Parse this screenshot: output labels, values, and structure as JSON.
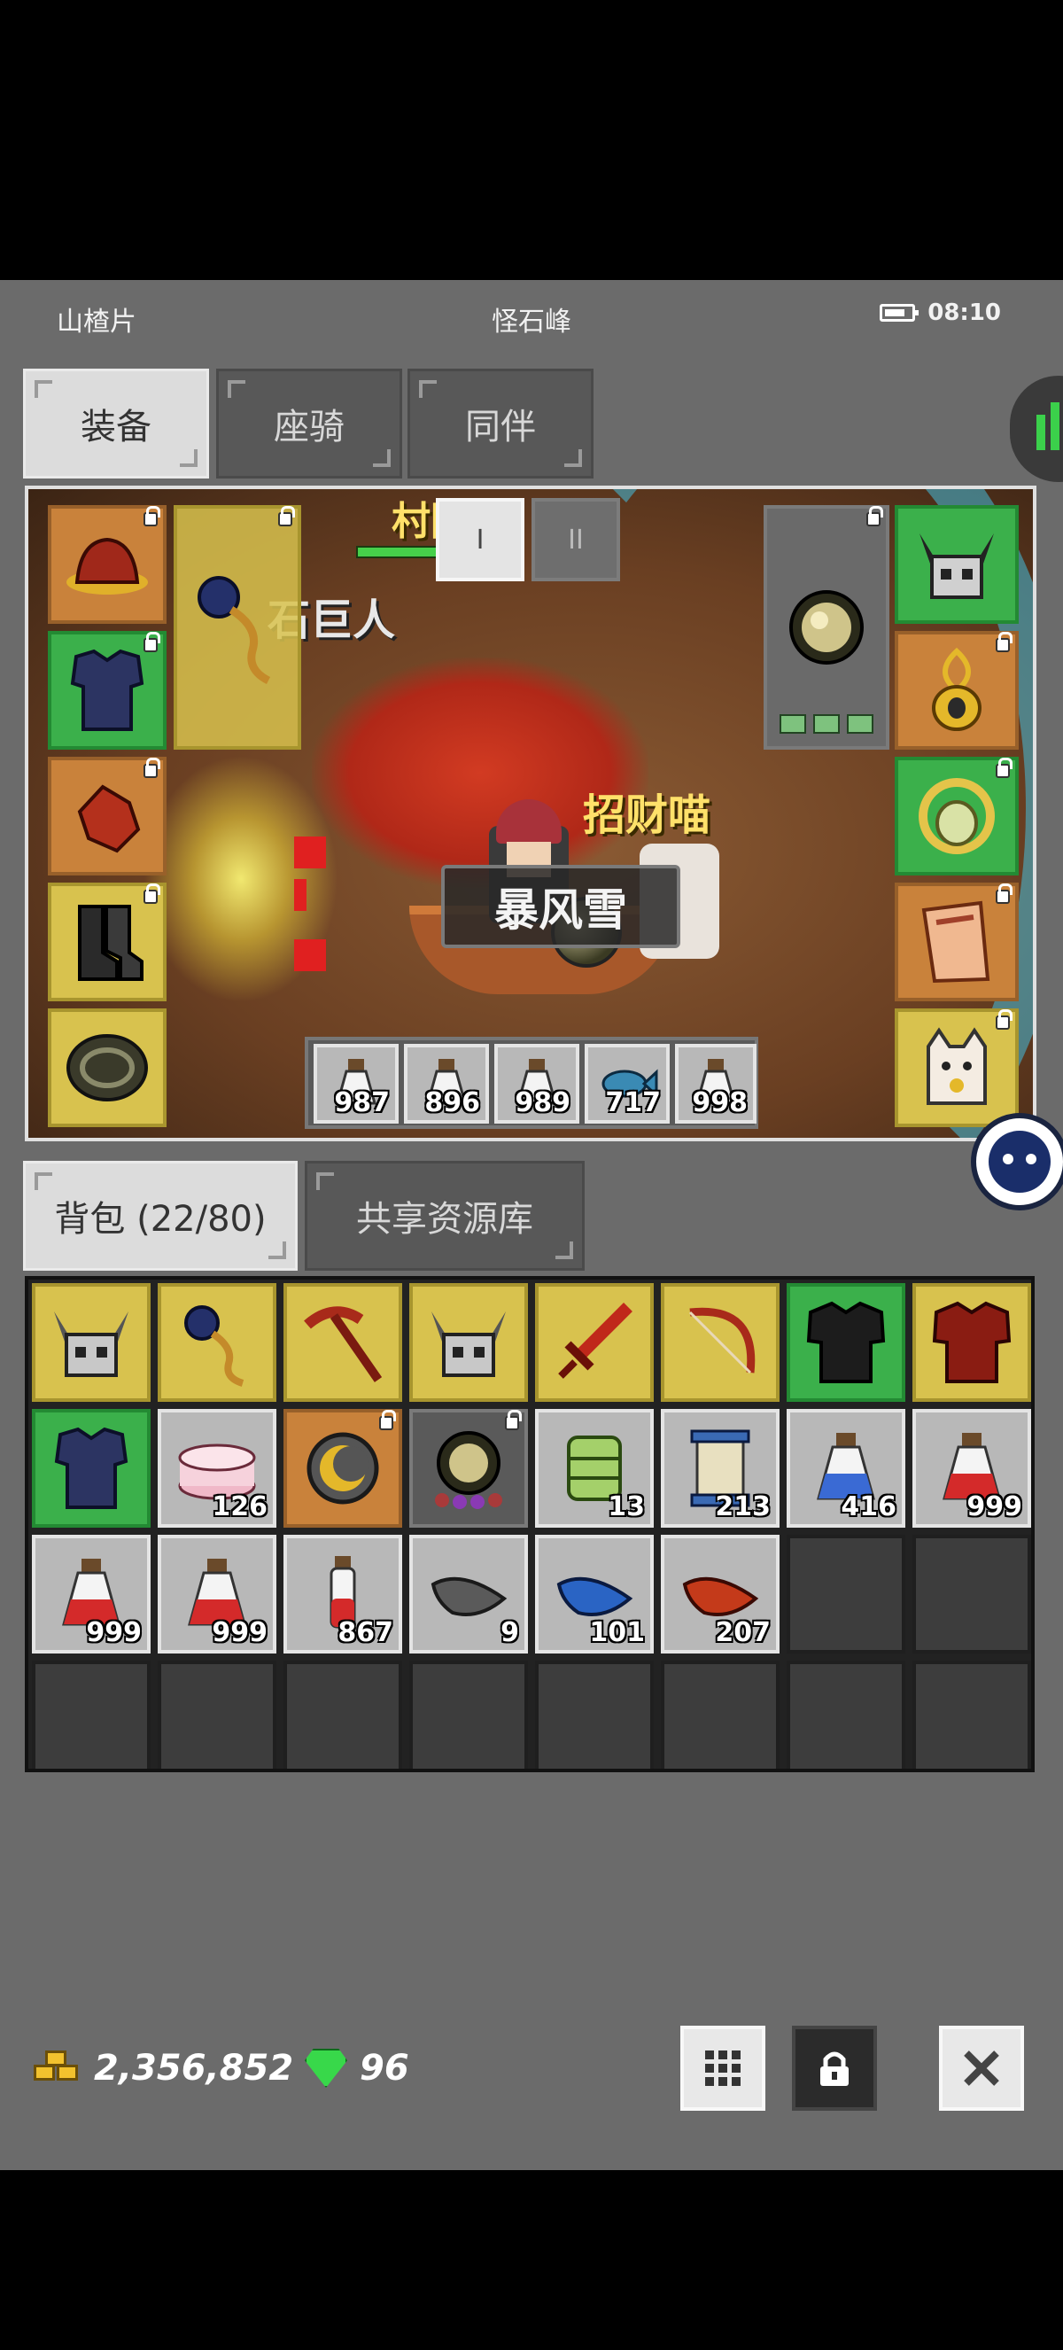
{
  "status_bar": {
    "left": "山楂片",
    "center": "怪石峰",
    "time": "08:10"
  },
  "tabs_top": [
    {
      "label": "装备",
      "active": true
    },
    {
      "label": "座骑",
      "active": false
    },
    {
      "label": "同伴",
      "active": false
    }
  ],
  "scene": {
    "top_label": "村园",
    "name_label": "石巨人",
    "skill_name": "暴风雪",
    "pet_name": "招财喵",
    "lane_buttons": [
      "I",
      "II"
    ]
  },
  "equipment_left": [
    {
      "icon": "red-hat-icon",
      "color": "orange",
      "locked": true
    },
    {
      "icon": "blue-armor-icon",
      "color": "green",
      "locked": true
    },
    {
      "icon": "red-gloves-icon",
      "color": "orange",
      "locked": true
    },
    {
      "icon": "black-boots-icon",
      "color": "yellow",
      "locked": true
    },
    {
      "icon": "coiled-belt-icon",
      "color": "yellow",
      "locked": false
    }
  ],
  "equipment_weapon": {
    "icon": "blue-staff-icon",
    "color": "yellow",
    "locked": true
  },
  "equipment_offhand": {
    "icon": "gold-orb-icon",
    "locked": true,
    "gems": 3
  },
  "equipment_right": [
    {
      "icon": "horned-skull-helm-icon",
      "color": "green",
      "locked": false
    },
    {
      "icon": "gold-amulet-icon",
      "color": "orange",
      "locked": true
    },
    {
      "icon": "gold-ring-icon",
      "color": "green",
      "locked": true
    },
    {
      "icon": "scroll-cloak-icon",
      "color": "orange",
      "locked": true
    },
    {
      "icon": "lucky-cat-charm-icon",
      "color": "yellow",
      "locked": true
    }
  ],
  "quick_slots": [
    {
      "icon": "white-potion-icon",
      "count": "987"
    },
    {
      "icon": "white-potion-icon",
      "count": "896"
    },
    {
      "icon": "white-potion-icon",
      "count": "989"
    },
    {
      "icon": "blue-fish-icon",
      "count": "717"
    },
    {
      "icon": "white-potion-icon",
      "count": "998"
    }
  ],
  "tabs_bag": [
    {
      "label": "背包 (22/80)",
      "active": true
    },
    {
      "label": "共享资源库",
      "active": false
    }
  ],
  "inventory": [
    {
      "icon": "horned-skull-helm-icon",
      "color": "yellow",
      "count": ""
    },
    {
      "icon": "blue-staff-icon",
      "color": "yellow",
      "count": ""
    },
    {
      "icon": "red-pickaxe-icon",
      "color": "yellow",
      "count": ""
    },
    {
      "icon": "horned-skull-helm-icon",
      "color": "yellow",
      "count": ""
    },
    {
      "icon": "red-sword-icon",
      "color": "yellow",
      "count": ""
    },
    {
      "icon": "red-bow-icon",
      "color": "yellow",
      "count": ""
    },
    {
      "icon": "black-armor-icon",
      "color": "green",
      "count": ""
    },
    {
      "icon": "red-armor-icon",
      "color": "yellow",
      "count": ""
    },
    {
      "icon": "blue-armor-icon",
      "color": "green",
      "count": ""
    },
    {
      "icon": "pink-cake-icon",
      "color": "gray",
      "count": "126"
    },
    {
      "icon": "gold-moon-disc-icon",
      "color": "orange",
      "count": "",
      "locked": true
    },
    {
      "icon": "gold-orb-icon",
      "color": "darkgray",
      "count": "",
      "locked": true
    },
    {
      "icon": "green-bundle-icon",
      "color": "gray",
      "count": "13"
    },
    {
      "icon": "blue-scroll-icon",
      "color": "gray",
      "count": "213"
    },
    {
      "icon": "blue-potion-icon",
      "color": "gray",
      "count": "416"
    },
    {
      "icon": "red-potion-icon",
      "color": "gray",
      "count": "999"
    },
    {
      "icon": "red-potion-icon",
      "color": "gray",
      "count": "999"
    },
    {
      "icon": "red-potion-icon",
      "color": "gray",
      "count": "999"
    },
    {
      "icon": "red-vial-icon",
      "color": "gray",
      "count": "867"
    },
    {
      "icon": "gray-feather-icon",
      "color": "gray",
      "count": "9"
    },
    {
      "icon": "blue-feather-icon",
      "color": "gray",
      "count": "101"
    },
    {
      "icon": "red-feather-icon",
      "color": "gray",
      "count": "207"
    }
  ],
  "currency": {
    "gold": "2,356,852",
    "gems": "96"
  },
  "colors": {
    "yellow": "#d8c24e",
    "green": "#3bb04b",
    "orange": "#c9823b",
    "gray": "#b8b8b8",
    "panel": "#6b6b6b"
  }
}
